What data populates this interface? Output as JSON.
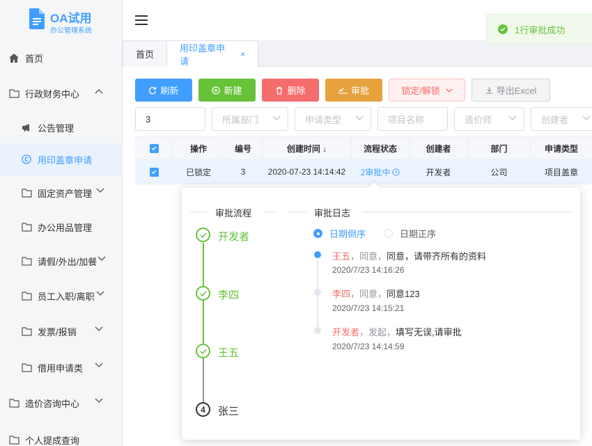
{
  "app": {
    "title": "OA试用",
    "subtitle": "办公管理系统"
  },
  "sidebar": {
    "items": [
      {
        "label": "首页",
        "icon": "home-icon"
      },
      {
        "label": "行政财务中心",
        "icon": "folder-icon",
        "expanded": true
      },
      {
        "label": "公告管理",
        "icon": "megaphone-icon"
      },
      {
        "label": "用印盖章申请",
        "icon": "copyright-icon",
        "active": true
      },
      {
        "label": "固定资产管理",
        "icon": "folder-icon"
      },
      {
        "label": "办公用品管理",
        "icon": "folder-icon"
      },
      {
        "label": "请假/外出/加餐",
        "icon": "folder-icon"
      },
      {
        "label": "员工入职/离职",
        "icon": "folder-icon"
      },
      {
        "label": "发票/报销",
        "icon": "folder-icon"
      },
      {
        "label": "借用申请类",
        "icon": "folder-icon"
      },
      {
        "label": "造价咨询中心",
        "icon": "folder-icon"
      },
      {
        "label": "个人提成查询",
        "icon": "folder-icon"
      }
    ]
  },
  "toast": {
    "message": "1行审批成功"
  },
  "tabs": [
    {
      "label": "首页"
    },
    {
      "label": "用印盖章申请",
      "active": true,
      "close": "×"
    }
  ],
  "toolbar": {
    "refresh": "刷新",
    "new": "新建",
    "delete": "删除",
    "audit": "审批",
    "lock": "锁定/解锁",
    "export": "导出Excel"
  },
  "filters": {
    "number_value": "3",
    "dept": "所属部门",
    "apply_type": "申请类型",
    "project": "项目名称",
    "cost_engineer": "造价师",
    "creator": "创建者"
  },
  "table": {
    "headers": [
      "操作",
      "编号",
      "创建时间 ↓",
      "流程状态",
      "创建者",
      "部门",
      "申请类型"
    ],
    "rows": [
      {
        "op": "已锁定",
        "id": "3",
        "created": "2020-07-23 14:14:42",
        "status": "2审批中",
        "creator": "开发者",
        "dept": "公司",
        "type": "项目盖章"
      }
    ]
  },
  "popover": {
    "flow_title": "审批流程",
    "log_title": "审批日志",
    "steps": [
      {
        "name": "开发者",
        "state": "done"
      },
      {
        "name": "李四",
        "state": "done"
      },
      {
        "name": "王五",
        "state": "done"
      },
      {
        "name": "张三",
        "state": "current",
        "number": "4"
      }
    ],
    "sort_desc": "日期倒序",
    "sort_asc": "日期正序",
    "logs": [
      {
        "who": "王五",
        "action": "，同意，",
        "comment": "同意，请带齐所有的资料",
        "time": "2020/7/23 14:16:26"
      },
      {
        "who": "李四",
        "action": "，同意，",
        "comment": "同意123",
        "time": "2020/7/23 14:15:21"
      },
      {
        "who": "开发者",
        "action": "，发起，",
        "comment": "填写无误,请审批",
        "time": "2020/7/23 14:14:59"
      }
    ]
  },
  "colors": {
    "primary": "#409eff",
    "success": "#67c23a",
    "danger": "#f56c6c",
    "warning": "#e6a23c"
  }
}
